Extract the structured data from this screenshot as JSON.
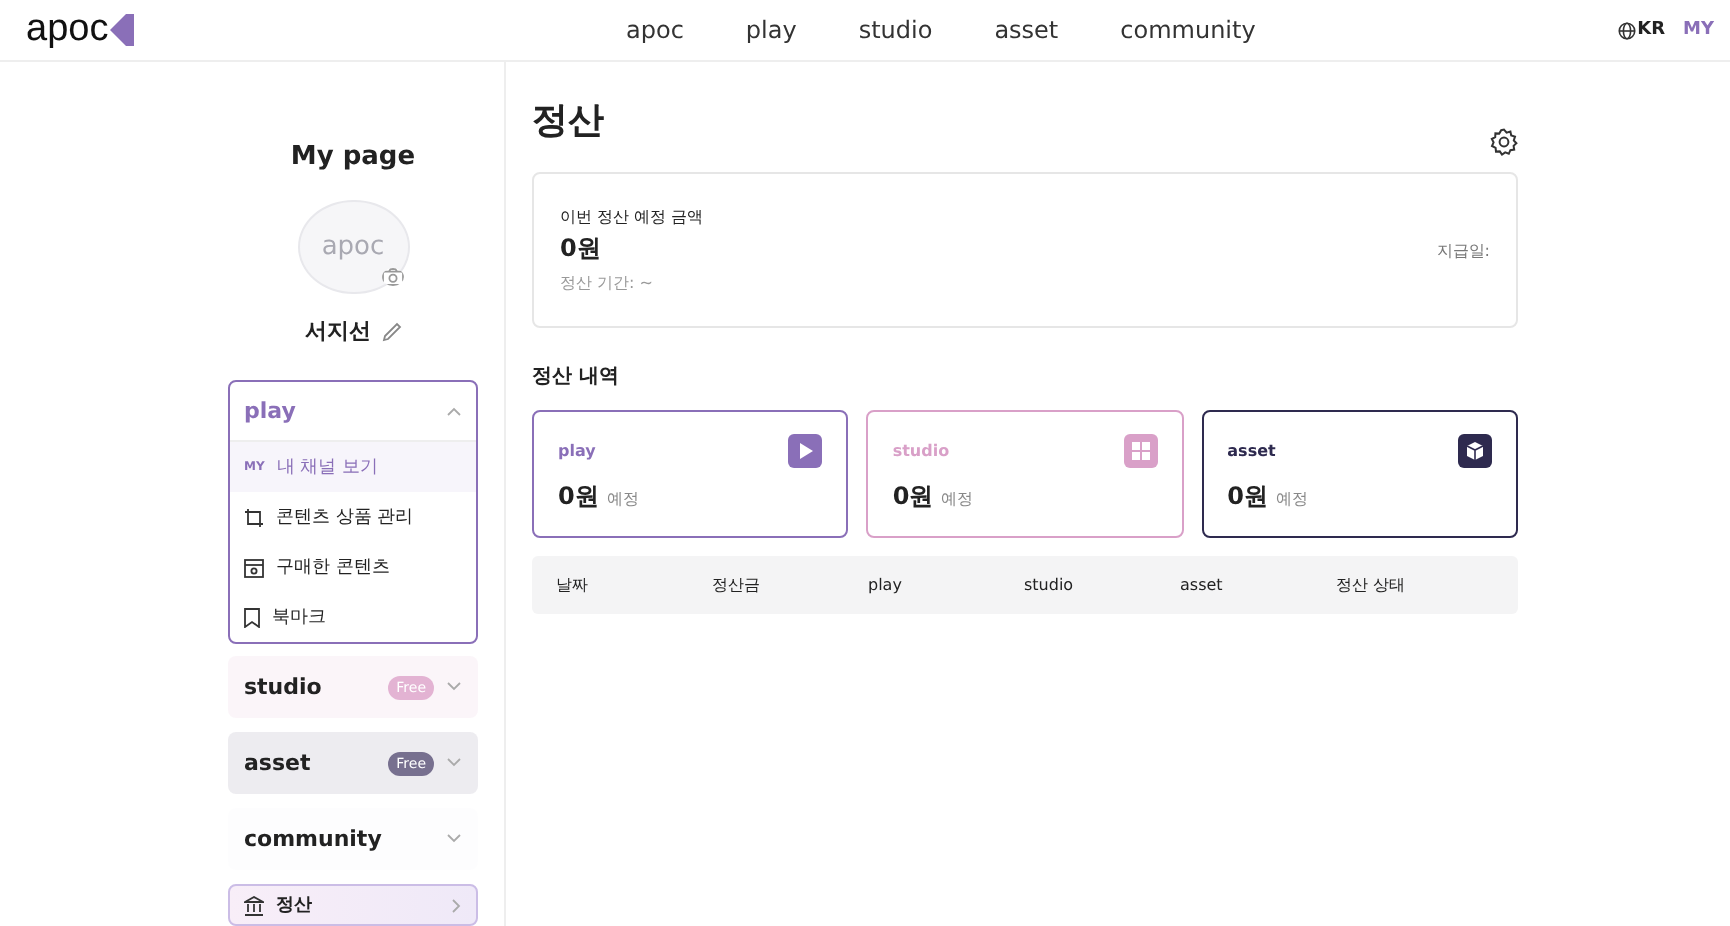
{
  "header": {
    "logo": "apoc",
    "nav": [
      {
        "label": "apoc"
      },
      {
        "label": "play"
      },
      {
        "label": "studio"
      },
      {
        "label": "asset"
      },
      {
        "label": "community"
      }
    ],
    "language": "KR",
    "my": "MY"
  },
  "sidebar": {
    "title": "My page",
    "avatar_logo": "apoc",
    "user_name": "서지선",
    "groups": [
      {
        "label": "play",
        "expanded": true,
        "color": "#8a6fb8",
        "items": [
          {
            "label": "내 채널 보기",
            "kind": "my",
            "prefix": "MY",
            "selected": true
          },
          {
            "label": "콘텐츠 상품 관리",
            "kind": "manage",
            "selected": false
          },
          {
            "label": "구매한 콘텐츠",
            "kind": "purchased",
            "selected": false
          },
          {
            "label": "북마크",
            "kind": "bookmark",
            "selected": false
          }
        ]
      },
      {
        "label": "studio",
        "expanded": false,
        "color": "#e3b3d3",
        "badge": "Free"
      },
      {
        "label": "asset",
        "expanded": false,
        "color": "#77708f",
        "badge": "Free"
      },
      {
        "label": "community",
        "expanded": false,
        "color": "#f2f1f6"
      }
    ],
    "settlement": {
      "label": "정산",
      "selected": true
    }
  },
  "main": {
    "title": "정산",
    "summary": {
      "label": "이번 정산 예정 금액",
      "amount": "0원",
      "period": "정산 기간: ~",
      "pay_date": "지급일:"
    },
    "history_title": "정산 내역",
    "cards": [
      {
        "label": "play",
        "amount": "0원",
        "note": "예정",
        "kind": "play",
        "color": "#8a6fb8"
      },
      {
        "label": "studio",
        "amount": "0원",
        "note": "예정",
        "kind": "studio",
        "color": "#d9a0c8"
      },
      {
        "label": "asset",
        "amount": "0원",
        "note": "예정",
        "kind": "asset",
        "color": "#2e2a4f"
      }
    ],
    "table": {
      "columns": [
        "날짜",
        "정산금",
        "play",
        "studio",
        "asset",
        "정산 상태"
      ]
    }
  }
}
